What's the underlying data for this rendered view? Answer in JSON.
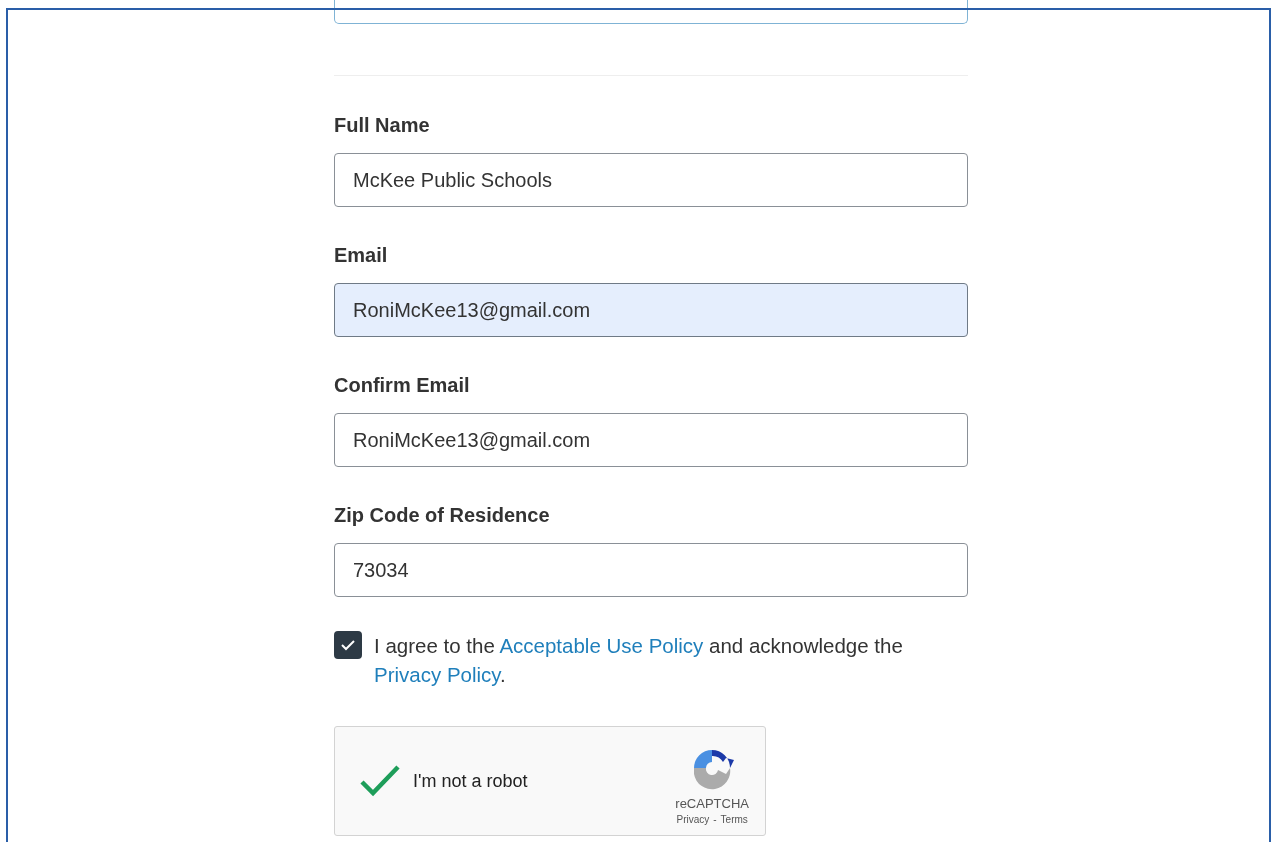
{
  "fields": [
    {
      "label": "Full Name",
      "value": "McKee Public Schools",
      "autofilled": false
    },
    {
      "label": "Email",
      "value": "RoniMcKee13@gmail.com",
      "autofilled": true
    },
    {
      "label": "Confirm Email",
      "value": "RoniMcKee13@gmail.com",
      "autofilled": false
    },
    {
      "label": "Zip Code of Residence",
      "value": "73034",
      "autofilled": false
    }
  ],
  "agreement": {
    "checked": true,
    "text_before": "I agree to the ",
    "link_policy": "Acceptable Use Policy",
    "text_middle": " and acknowledge the ",
    "link_privacy": "Privacy Policy",
    "text_after": "."
  },
  "recaptcha": {
    "checked": true,
    "label": "I'm not a robot",
    "brand": "reCAPTCHA",
    "privacy": "Privacy",
    "separator": "-",
    "terms": "Terms"
  }
}
